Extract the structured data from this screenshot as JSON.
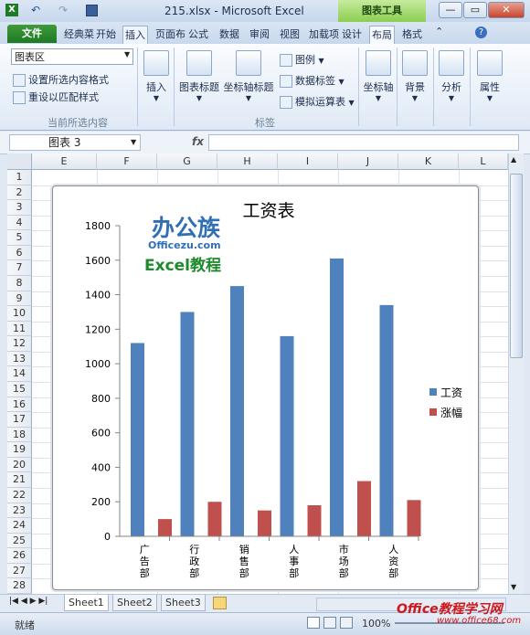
{
  "window": {
    "title": "215.xlsx - Microsoft Excel",
    "context_tab_group": "图表工具"
  },
  "tabs": {
    "file": "文件",
    "items": [
      "经典菜",
      "开始",
      "插入",
      "页面布",
      "公式",
      "数据",
      "审阅",
      "视图",
      "加载项",
      "设计",
      "布局",
      "格式"
    ],
    "active": "布局"
  },
  "ribbon": {
    "selection_combo": "图表区",
    "format_selection": "设置所选内容格式",
    "reset_style": "重设以匹配样式",
    "group_current_selection": "当前所选内容",
    "insert": "插入",
    "chart_title": "图表标题",
    "axis_titles": "坐标轴标题",
    "legend": "图例",
    "data_labels": "数据标签",
    "data_table": "模拟运算表",
    "group_labels": "标签",
    "axes": "坐标轴",
    "background": "背景",
    "analysis": "分析",
    "properties": "属性"
  },
  "formula_bar": {
    "name_box": "图表 3",
    "fx_label": "fx",
    "formula": ""
  },
  "sheet": {
    "columns": [
      "E",
      "F",
      "G",
      "H",
      "I",
      "J",
      "K",
      "L"
    ],
    "rows": [
      "1",
      "2",
      "3",
      "4",
      "5",
      "6",
      "7",
      "8",
      "9",
      "10",
      "11",
      "12",
      "13",
      "14",
      "15",
      "16",
      "17",
      "18",
      "19",
      "20",
      "21",
      "22",
      "23",
      "24",
      "25",
      "26",
      "27",
      "28"
    ],
    "tabs": [
      "Sheet1",
      "Sheet2",
      "Sheet3"
    ],
    "active_tab": "Sheet1"
  },
  "status": {
    "ready": "就绪",
    "zoom": "100%"
  },
  "watermark": {
    "logo_cn": "办公族",
    "logo_url": "Officezu.com",
    "logo_sub": "Excel教程",
    "corner": "Office教程学习网",
    "corner_url": "www.office68.com"
  },
  "chart_data": {
    "type": "bar",
    "title": "工资表",
    "categories": [
      "广告部",
      "行政部",
      "销售部",
      "人事部",
      "市场部",
      "人资部"
    ],
    "series": [
      {
        "name": "工资",
        "color": "#4f81bd",
        "values": [
          1120,
          1300,
          1450,
          1160,
          1610,
          1340
        ]
      },
      {
        "name": "涨幅",
        "color": "#c0504d",
        "values": [
          100,
          200,
          150,
          180,
          320,
          210
        ]
      }
    ],
    "ylim": [
      0,
      1800
    ],
    "yticks": [
      0,
      200,
      400,
      600,
      800,
      1000,
      1200,
      1400,
      1600,
      1800
    ],
    "legend_position": "right",
    "grid": false
  }
}
